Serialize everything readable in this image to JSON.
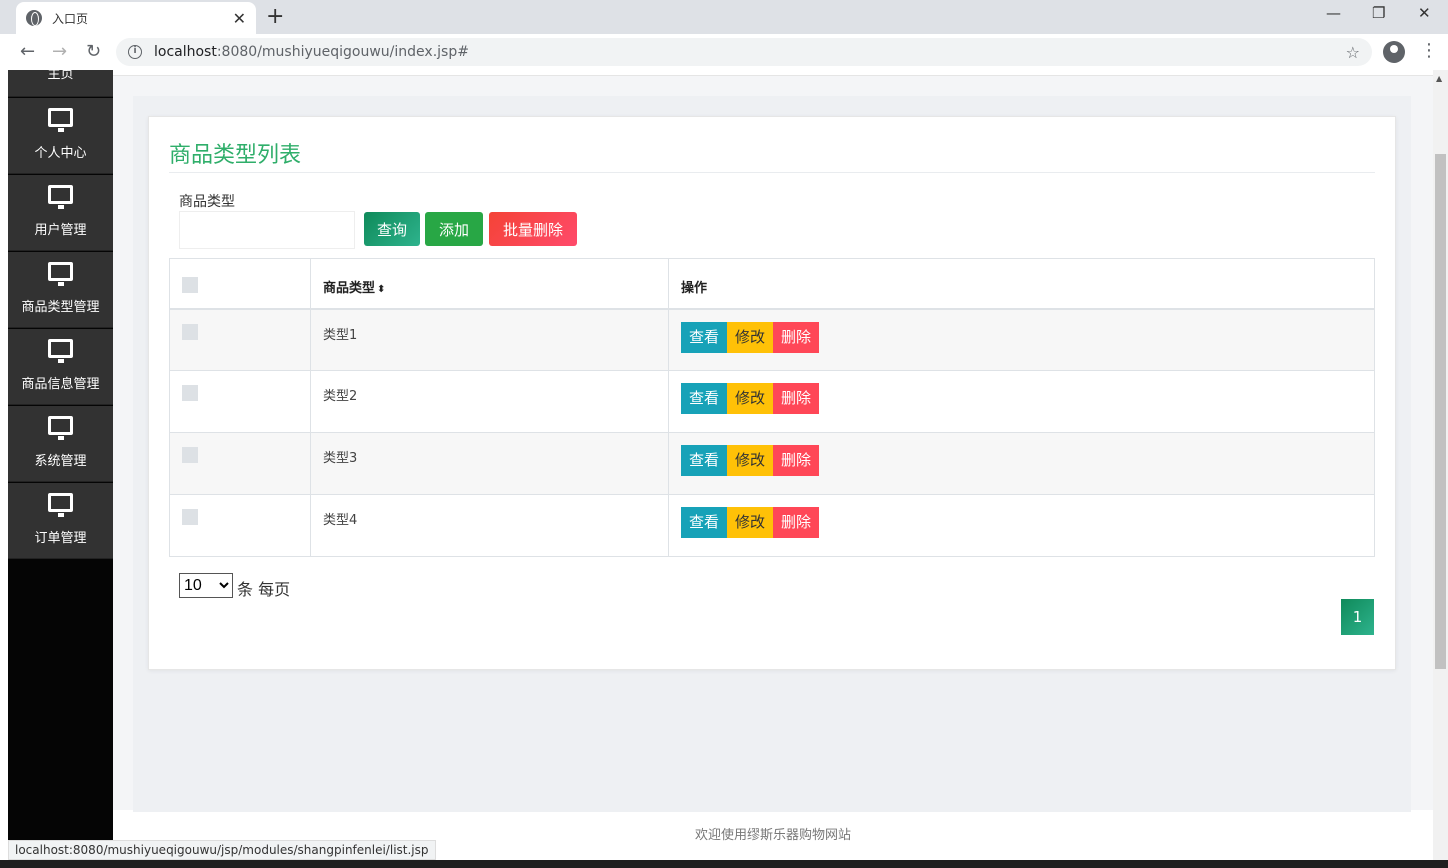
{
  "browser": {
    "tab_title": "入口页",
    "tab_close": "✕",
    "new_tab": "+",
    "url_host": "localhost",
    "url_rest": ":8080/mushiyueqigouwu/index.jsp#",
    "minimize": "—",
    "restore": "❐",
    "close": "✕",
    "back": "←",
    "forward": "→",
    "reload": "↻",
    "star": "☆",
    "menu": "⋮",
    "status_url": "localhost:8080/mushiyueqigouwu/jsp/modules/shangpinfenlei/list.jsp"
  },
  "sidebar": {
    "top_item": "主页",
    "items": [
      {
        "label": "个人中心"
      },
      {
        "label": "用户管理"
      },
      {
        "label": "商品类型管理"
      },
      {
        "label": "商品信息管理"
      },
      {
        "label": "系统管理"
      },
      {
        "label": "订单管理"
      }
    ]
  },
  "main": {
    "title": "商品类型列表",
    "search_label": "商品类型",
    "search_value": "",
    "query_button": "查询",
    "add_button": "添加",
    "batch_delete_button": "批量删除",
    "table": {
      "columns": [
        "商品类型",
        "操作"
      ],
      "sort_icon": "⬍",
      "rows": [
        {
          "type": "类型1"
        },
        {
          "type": "类型2"
        },
        {
          "type": "类型3"
        },
        {
          "type": "类型4"
        }
      ],
      "actions": {
        "view": "查看",
        "edit": "修改",
        "delete": "删除"
      }
    },
    "page_size": "10",
    "page_size_label": "条 每页",
    "current_page": "1"
  },
  "footer": {
    "text": "欢迎使用缪斯乐器购物网站"
  },
  "colors": {
    "accent": "#2fae6a",
    "sidebar": "#323232",
    "view": "#17a2b8",
    "edit": "#ffc107",
    "delete": "#ff4757"
  }
}
